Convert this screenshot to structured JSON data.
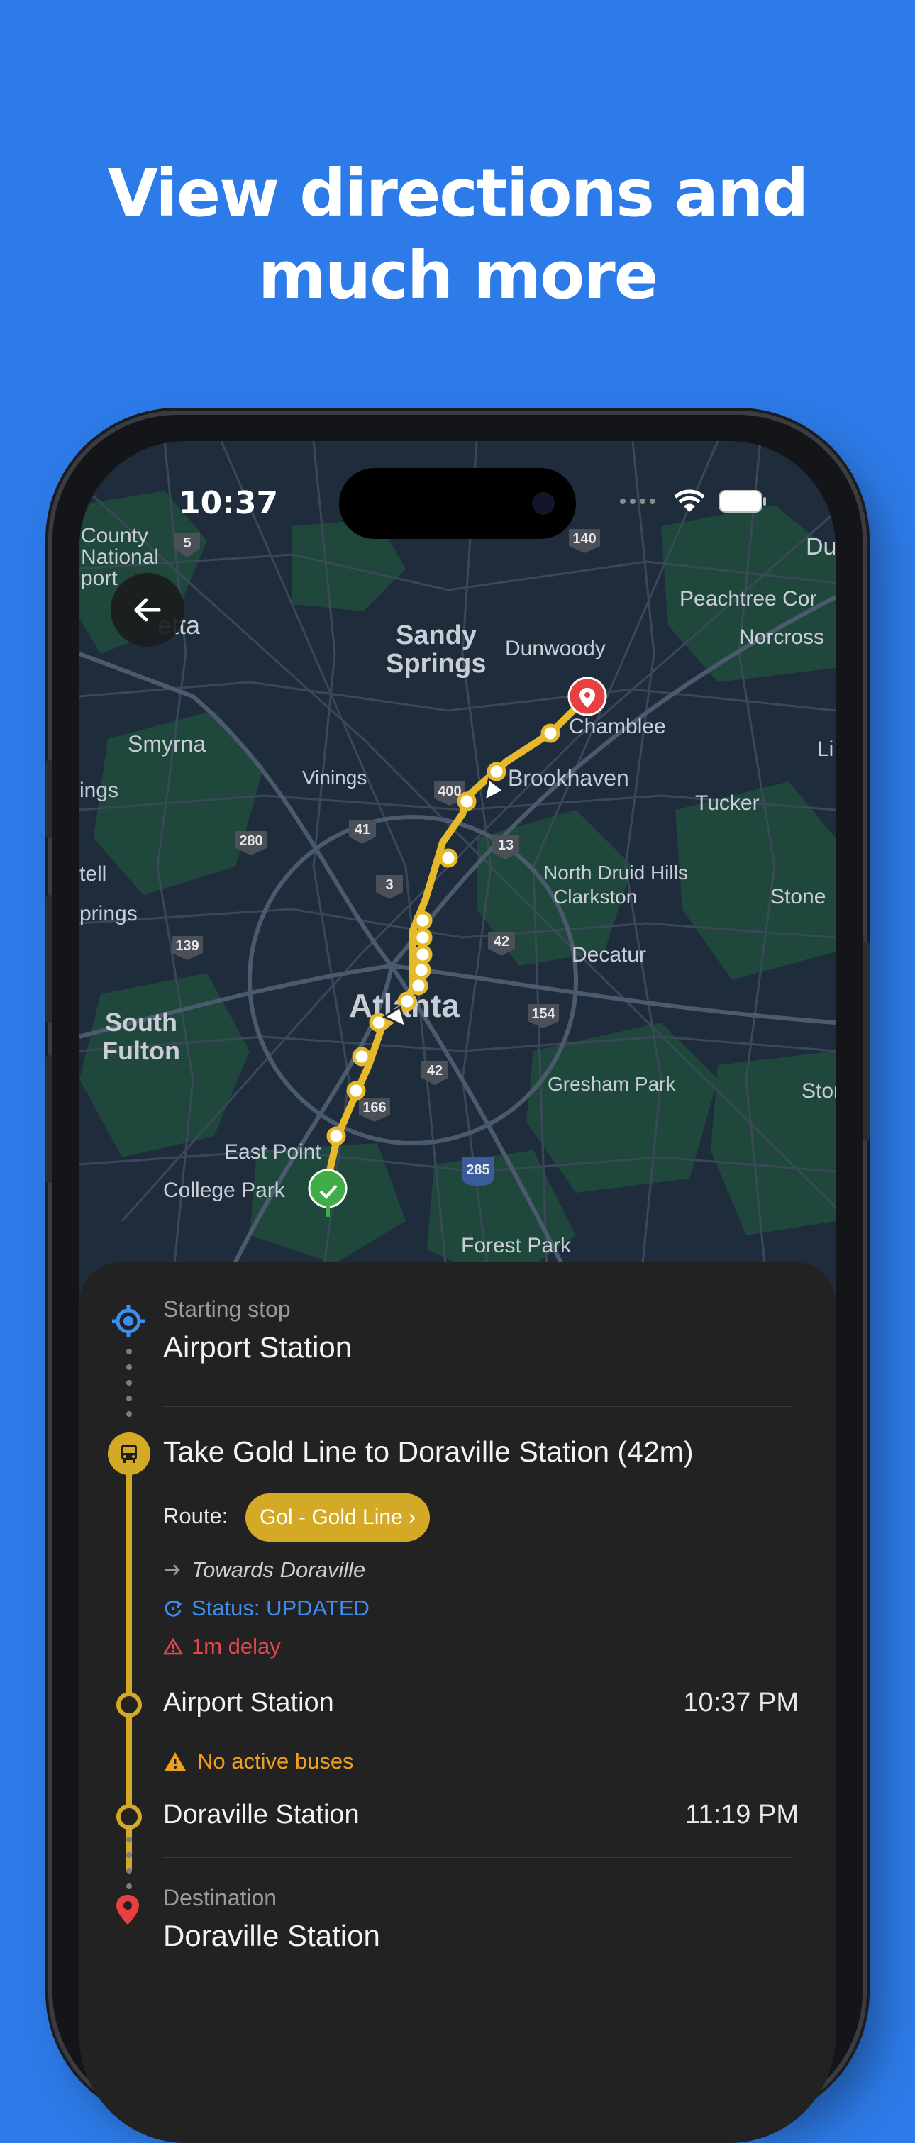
{
  "headline": {
    "line1": "View directions and",
    "line2": "much more"
  },
  "status_bar": {
    "time": "10:37"
  },
  "map": {
    "labels": {
      "county_national_airport_1": "County",
      "county_national_airport_2": "National",
      "county_national_airport_3": "port",
      "hw5": "5",
      "hw140": "140",
      "du": "Du",
      "marietta": "etta",
      "peachtree": "Peachtree Cor",
      "sandy_springs_1": "Sandy",
      "sandy_springs_2": "Springs",
      "dunwoody": "Dunwoody",
      "norcross": "Norcross",
      "smyrna": "Smyrna",
      "chamblee": "Chamblee",
      "li": "Li",
      "vinings": "Vinings",
      "ings": "ings",
      "hw400": "400",
      "brookhaven": "Brookhaven",
      "tucker": "Tucker",
      "hw280": "280",
      "hw41": "41",
      "hw13": "13",
      "tell": "tell",
      "hw3": "3",
      "north_druid": "North Druid Hills",
      "clarkston": "Clarkston",
      "stone": "Stone",
      "prings": "prings",
      "hw42a": "42",
      "hw139": "139",
      "decatur": "Decatur",
      "south_fulton_1": "South",
      "south_fulton_2": "Fulton",
      "atlanta": "Atlanta",
      "hw154": "154",
      "hw42b": "42",
      "gresham": "Gresham Park",
      "stone2": "Stone",
      "hw166": "166",
      "east_point": "East Point",
      "hw285": "285",
      "college_park": "College Park",
      "forest_park": "Forest Park"
    }
  },
  "sheet": {
    "start_label": "Starting stop",
    "start_name": "Airport Station",
    "take_title": "Take Gold Line to Doraville Station (42m)",
    "route_label": "Route:",
    "route_pill": "Gol - Gold Line ›",
    "towards": "Towards Doraville",
    "status": "Status: UPDATED",
    "delay": "1m delay",
    "stop1_name": "Airport Station",
    "stop1_time": "10:37 PM",
    "no_buses": "No active buses",
    "stop2_name": "Doraville Station",
    "stop2_time": "11:19 PM",
    "dest_label": "Destination",
    "dest_name": "Doraville Station"
  },
  "colors": {
    "background": "#2d7be8",
    "gold_line": "#d4a925",
    "status_blue": "#3d8ef0",
    "delay_red": "#e5484d",
    "warning_orange": "#f0a020"
  },
  "icons": {
    "back": "arrow-left-icon",
    "start": "crosshair-icon",
    "bus": "bus-icon",
    "dest": "pin-icon"
  }
}
